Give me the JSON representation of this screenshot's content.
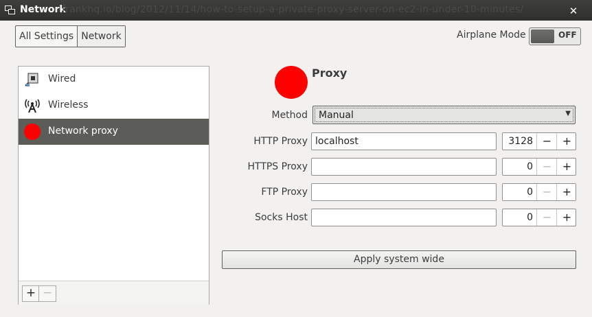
{
  "window": {
    "title": "Network",
    "ghost_url": "frankhq.io/blog/2012/11/14/how-to-setup-a-private-proxy-server-on-ec2-in-under-10-minutes/"
  },
  "header": {
    "breadcrumbs": [
      "All Settings",
      "Network"
    ],
    "airplane_mode_label": "Airplane Mode",
    "airplane_mode_state": "OFF"
  },
  "sidebar": {
    "items": [
      {
        "label": "Wired",
        "icon": "wired-network-icon",
        "selected": false
      },
      {
        "label": "Wireless",
        "icon": "wireless-antenna-icon",
        "selected": false
      },
      {
        "label": "Network proxy",
        "icon": "red-dot-icon",
        "selected": true
      }
    ],
    "add_label": "+",
    "remove_label": "−"
  },
  "proxy": {
    "title": "Proxy",
    "method_label": "Method",
    "method_value": "Manual",
    "fields": [
      {
        "label": "HTTP Proxy",
        "host": "localhost",
        "port": "3128"
      },
      {
        "label": "HTTPS Proxy",
        "host": "",
        "port": "0"
      },
      {
        "label": "FTP Proxy",
        "host": "",
        "port": "0"
      },
      {
        "label": "Socks Host",
        "host": "",
        "port": "0"
      }
    ],
    "apply_label": "Apply system wide"
  },
  "colors": {
    "accent_red": "#ff0000",
    "titlebar": "#3c3b37",
    "selected_row": "#5c5c59"
  }
}
